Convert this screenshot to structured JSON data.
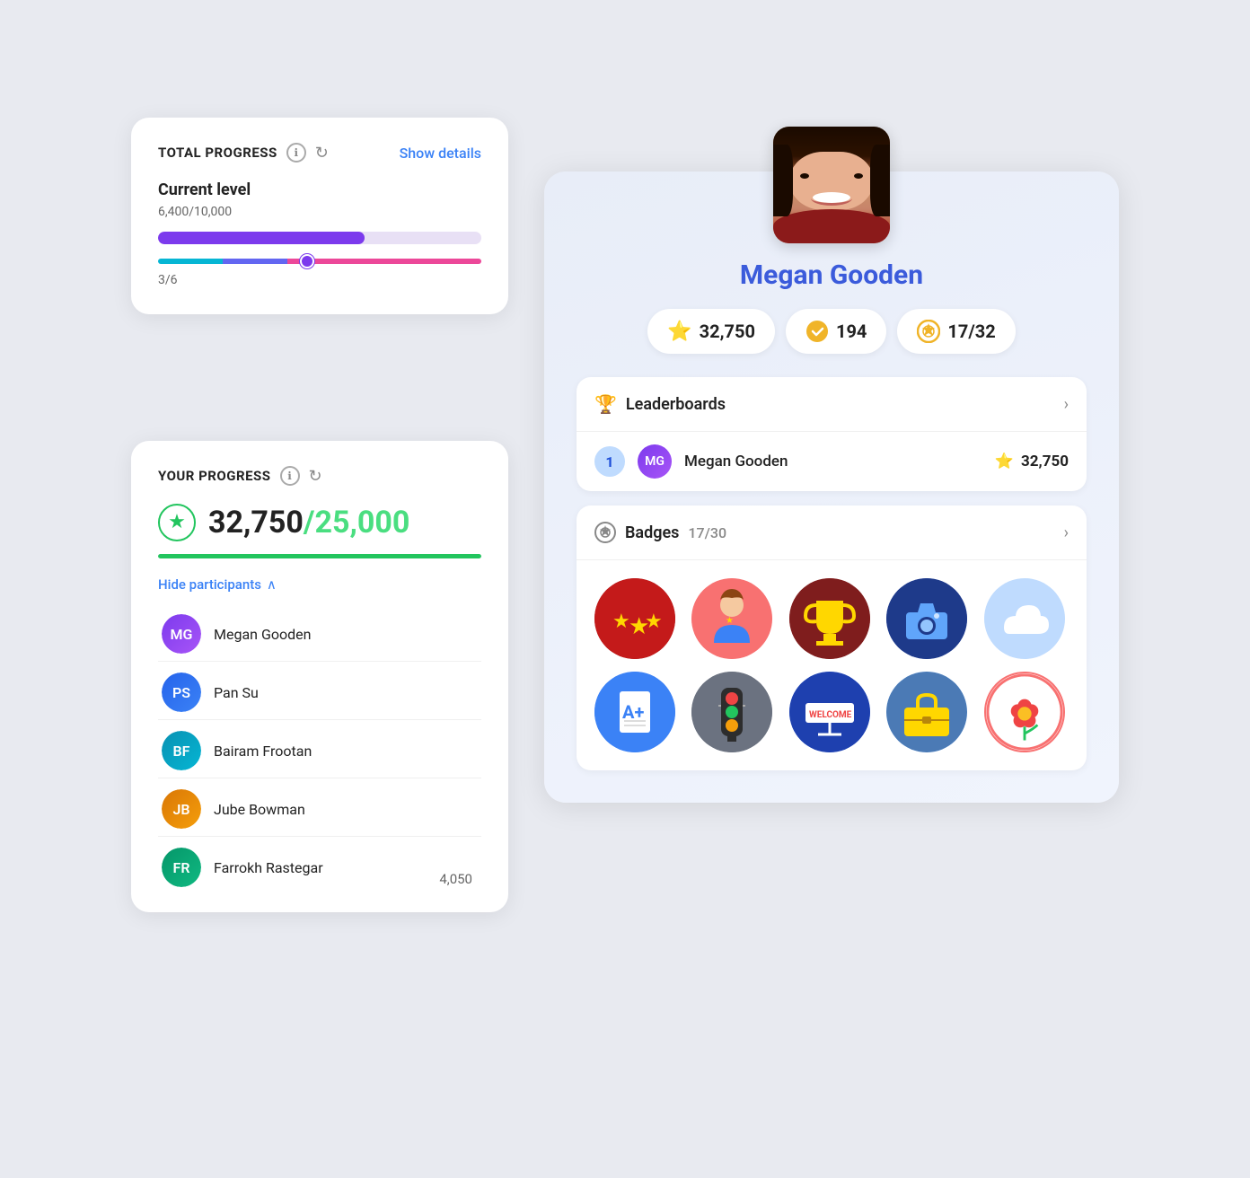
{
  "total_progress": {
    "title": "TOTAL PROGRESS",
    "info_icon": "ℹ",
    "refresh_icon": "↻",
    "show_details": "Show details",
    "current_level_label": "Current level",
    "level_fraction": "6,400/10,000",
    "progress_fill_pct": "64",
    "step_fraction": "3/6"
  },
  "your_progress": {
    "title": "YOUR PROGRESS",
    "info_icon": "ℹ",
    "refresh_icon": "↻",
    "score": "32,750",
    "target": "/25,000",
    "bar_pct": "100",
    "hide_participants": "Hide participants"
  },
  "participants": [
    {
      "name": "Megan Gooden",
      "color": "av-purple",
      "initials": "MG"
    },
    {
      "name": "Pan Su",
      "color": "av-blue",
      "initials": "PS"
    },
    {
      "name": "Bairam Frootan",
      "color": "av-teal",
      "initials": "BF"
    },
    {
      "name": "Jube Bowman",
      "color": "av-orange",
      "initials": "JB"
    },
    {
      "name": "Farrokh Rastegar",
      "color": "av-green",
      "initials": "FR"
    }
  ],
  "farrokh_score": "4,050",
  "profile": {
    "name": "Megan Gooden",
    "stats": {
      "stars": "32,750",
      "completions": "194",
      "badges": "17/32"
    },
    "leaderboard": {
      "section_title": "Leaderboards",
      "rank": "1",
      "entry_name": "Megan Gooden",
      "entry_score": "32,750"
    },
    "badges": {
      "section_title": "Badges",
      "count": "17/30",
      "items": [
        {
          "name": "stars-badge",
          "emoji": "⭐",
          "style": "badge-stars"
        },
        {
          "name": "person-badge",
          "emoji": "👤",
          "style": "badge-person"
        },
        {
          "name": "trophy-badge",
          "emoji": "🏆",
          "style": "badge-trophy"
        },
        {
          "name": "camera-badge",
          "emoji": "📷",
          "style": "badge-camera"
        },
        {
          "name": "cloud-badge",
          "emoji": "☁",
          "style": "badge-cloud"
        },
        {
          "name": "grade-badge",
          "emoji": "📄",
          "style": "badge-grade"
        },
        {
          "name": "traffic-badge",
          "emoji": "🚦",
          "style": "badge-traffic"
        },
        {
          "name": "welcome-badge",
          "emoji": "🪧",
          "style": "badge-welcome"
        },
        {
          "name": "briefcase-badge",
          "emoji": "💼",
          "style": "badge-briefcase"
        },
        {
          "name": "flower-badge",
          "emoji": "🌸",
          "style": "badge-flower"
        }
      ]
    }
  },
  "icons": {
    "info": "ℹ",
    "refresh": "↻",
    "chevron_right": "›",
    "chevron_up": "∧",
    "trophy": "🏆",
    "medal": "🥇",
    "star_yellow": "⭐",
    "star_green": "★",
    "check": "✔"
  }
}
